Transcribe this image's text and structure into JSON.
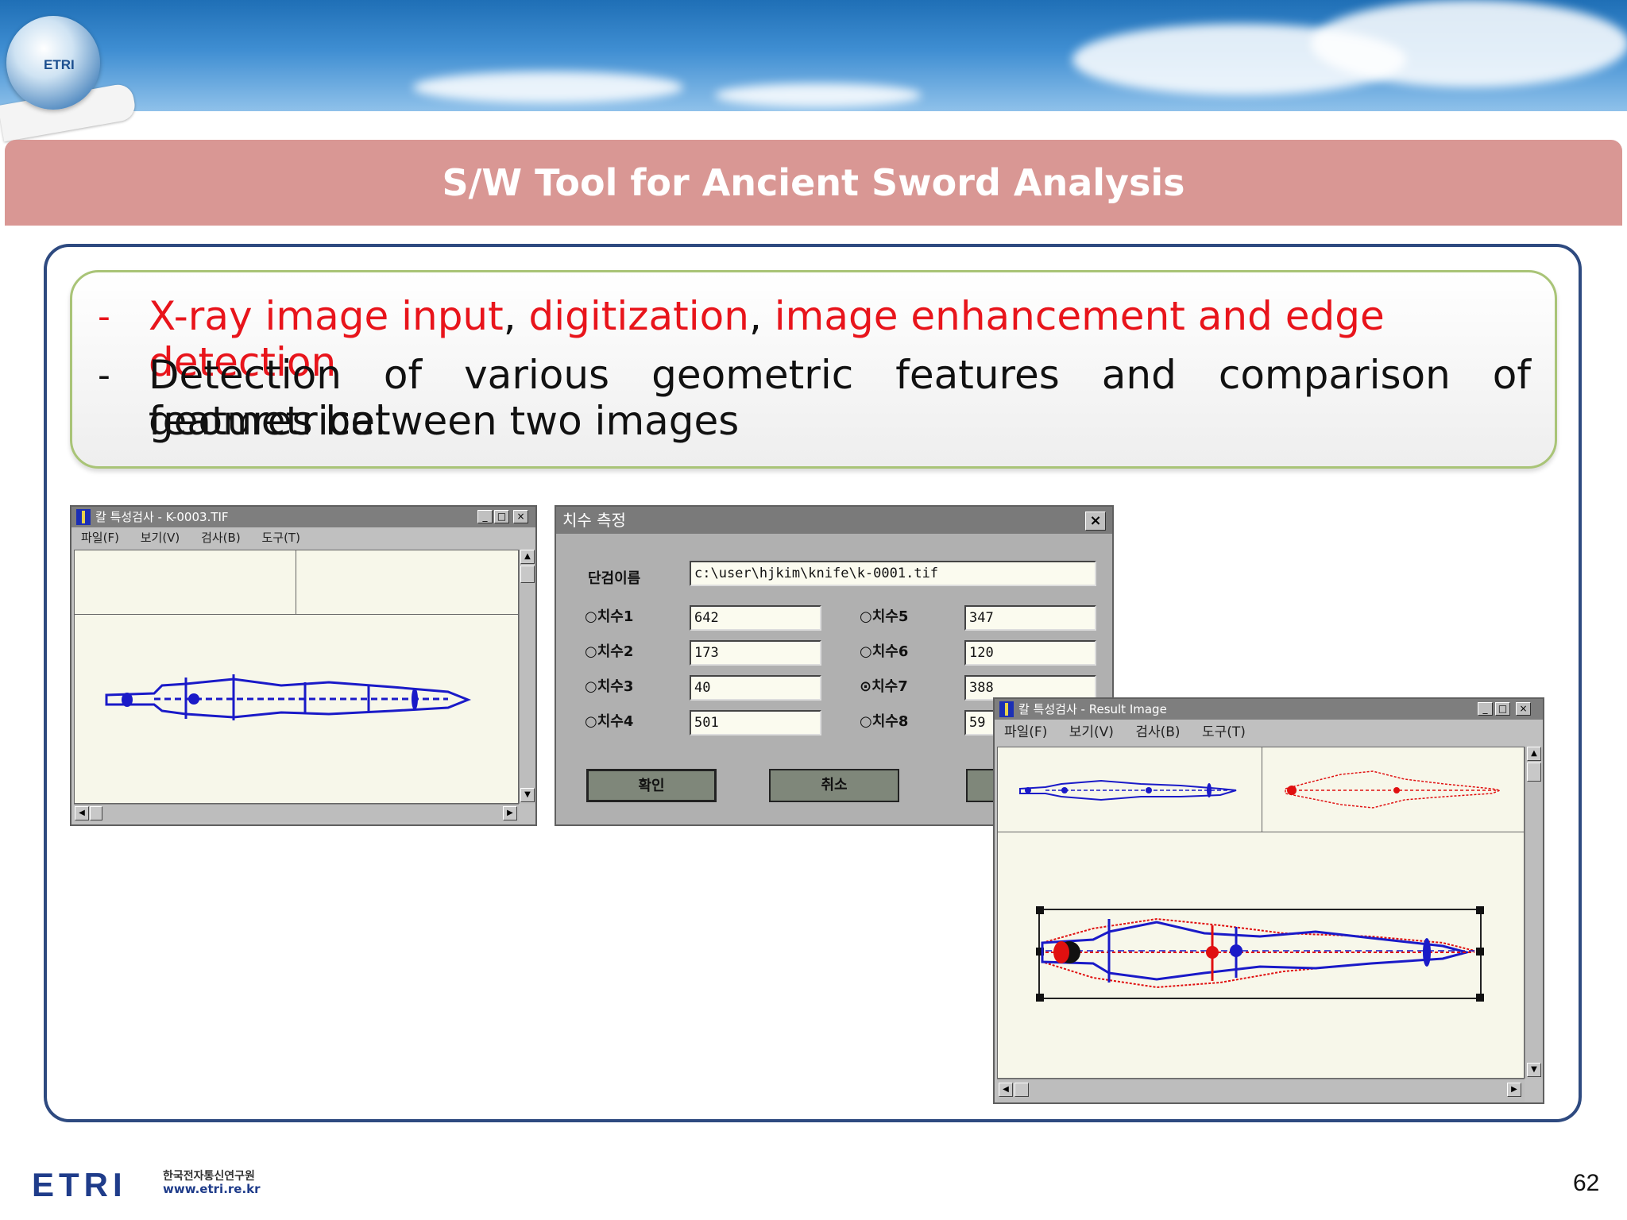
{
  "slide": {
    "title": "S/W Tool for Ancient Sword Analysis",
    "bullets": [
      {
        "dash": "-",
        "parts": [
          "X-ray image input",
          ", ",
          "digitization",
          ", ",
          "image enhancement and edge detection"
        ]
      },
      {
        "dash": "-",
        "line1": "Detection of various geometric features and comparison of geometrical",
        "line2": "features between two images"
      }
    ],
    "page_number": "62",
    "colors": {
      "title_bar": "#d99794",
      "highlight_text": "#e8141b",
      "frame_border": "#2e4a80",
      "box_border": "#a9c477"
    }
  },
  "header": {
    "logo_text": "ETRI"
  },
  "footer": {
    "logo": "ETRI",
    "org_name_korean": "한국전자통신연구원",
    "website": "www.etri.re.kr"
  },
  "window_left": {
    "title": "칼 특성검사 - K-0003.TIF",
    "menu": [
      "파일(F)",
      "보기(V)",
      "검사(B)",
      "도구(T)"
    ],
    "controls": {
      "minimize": "_",
      "maximize": "□",
      "close": "×"
    }
  },
  "dialog": {
    "title": "치수 측정",
    "close": "×",
    "name_label": "단검이름",
    "name_value": "c:\\user\\hjkim\\knife\\k-0001.tif",
    "measurements": [
      {
        "label": "치수1",
        "value": "642",
        "selected": false
      },
      {
        "label": "치수2",
        "value": "173",
        "selected": false
      },
      {
        "label": "치수3",
        "value": "40",
        "selected": false
      },
      {
        "label": "치수4",
        "value": "501",
        "selected": false
      },
      {
        "label": "치수5",
        "value": "347",
        "selected": false
      },
      {
        "label": "치수6",
        "value": "120",
        "selected": false
      },
      {
        "label": "치수7",
        "value": "388",
        "selected": true
      },
      {
        "label": "치수8",
        "value": "59",
        "selected": false
      }
    ],
    "buttons": {
      "ok": "확인",
      "cancel": "취소"
    }
  },
  "window_result": {
    "title": "칼 특성검사 - Result Image",
    "menu": [
      "파일(F)",
      "보기(V)",
      "검사(B)",
      "도구(T)"
    ],
    "controls": {
      "minimize": "_",
      "maximize": "□",
      "close": "×"
    }
  }
}
